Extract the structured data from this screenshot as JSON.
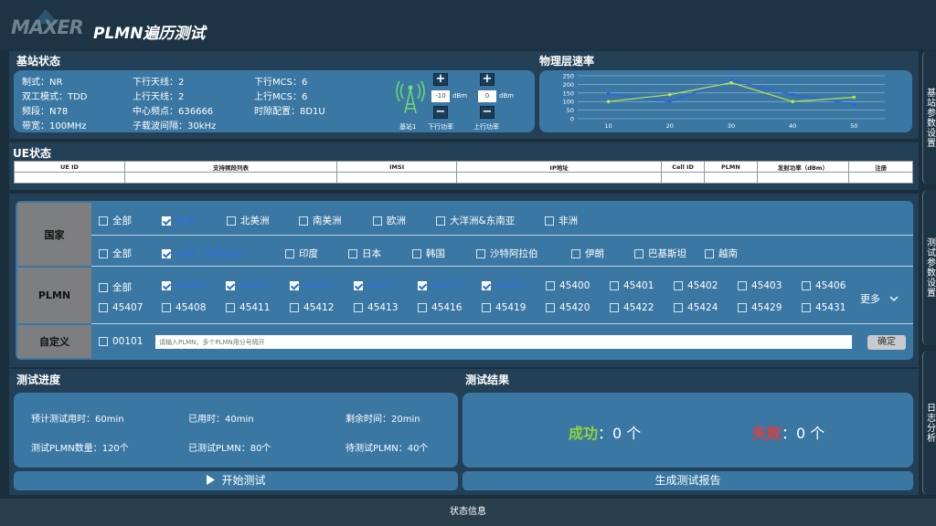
{
  "app": {
    "logo": "MAXER",
    "title": "PLMN遍历测试"
  },
  "base_station": {
    "title": "基站状态",
    "col1": [
      "制式：NR",
      "双工模式：TDD",
      "频段：N78",
      "带宽：100MHz"
    ],
    "col2": [
      "下行天线：2",
      "上行天线：2",
      "中心频点：636666",
      "子载波间隔：30kHz"
    ],
    "col3": [
      "下行MCS：6",
      "上行MCS：6",
      "时隙配置：8D1U"
    ],
    "antenna_label": "基站1",
    "dl_power": {
      "value": "-10",
      "unit": "dBm",
      "label": "下行功率"
    },
    "ul_power": {
      "value": "0",
      "unit": "dBm",
      "label": "上行功率"
    }
  },
  "rate": {
    "title": "物理层速率"
  },
  "chart_data": {
    "type": "line",
    "x": [
      10,
      20,
      30,
      40,
      50
    ],
    "series": [
      {
        "values": [
          145,
          100,
          225,
          140,
          85
        ]
      },
      {
        "values": [
          100,
          140,
          210,
          100,
          125
        ]
      }
    ],
    "xticks": [
      "10",
      "20",
      "30",
      "40",
      "50"
    ],
    "yticks": [
      "250",
      "200",
      "150",
      "100",
      "50",
      "0"
    ],
    "ylim": [
      0,
      250
    ],
    "grid": true,
    "colors": [
      "#2a63e0",
      "#b7e84e"
    ]
  },
  "ue": {
    "title": "UE状态",
    "columns": [
      "UE ID",
      "支持频段列表",
      "IMSI",
      "IP地址",
      "Cell ID",
      "PLMN",
      "发射功率（dBm）",
      "注册"
    ]
  },
  "country": {
    "label": "国家",
    "regions": [
      {
        "label": "全部",
        "checked": false
      },
      {
        "label": "亚洲",
        "checked": true
      },
      {
        "label": "北美洲",
        "checked": false
      },
      {
        "label": "南美洲",
        "checked": false
      },
      {
        "label": "欧洲",
        "checked": false
      },
      {
        "label": "大洋洲&东南亚",
        "checked": false
      },
      {
        "label": "非洲",
        "checked": false
      }
    ],
    "countries": [
      {
        "label": "全部",
        "checked": false
      },
      {
        "label": "中国（含港澳台）",
        "checked": true
      },
      {
        "label": "印度",
        "checked": false
      },
      {
        "label": "日本",
        "checked": false
      },
      {
        "label": "韩国",
        "checked": false
      },
      {
        "label": "沙特阿拉伯",
        "checked": false
      },
      {
        "label": "伊朗",
        "checked": false
      },
      {
        "label": "巴基斯坦",
        "checked": false
      },
      {
        "label": "越南",
        "checked": false
      }
    ]
  },
  "plmn": {
    "label": "PLMN",
    "row1": [
      {
        "label": "全部",
        "checked": false
      },
      {
        "label": "46000",
        "checked": true
      },
      {
        "label": "46001",
        "checked": true
      },
      {
        "label": "46003",
        "checked": true
      },
      {
        "label": "46011",
        "checked": true
      },
      {
        "label": "46015",
        "checked": true
      },
      {
        "label": "46020",
        "checked": true
      },
      {
        "label": "45400",
        "checked": false
      },
      {
        "label": "45401",
        "checked": false
      },
      {
        "label": "45402",
        "checked": false
      },
      {
        "label": "45403",
        "checked": false
      },
      {
        "label": "45406",
        "checked": false
      }
    ],
    "row2": [
      {
        "label": "45407",
        "checked": false
      },
      {
        "label": "45408",
        "checked": false
      },
      {
        "label": "45411",
        "checked": false
      },
      {
        "label": "45412",
        "checked": false
      },
      {
        "label": "45413",
        "checked": false
      },
      {
        "label": "45416",
        "checked": false
      },
      {
        "label": "45419",
        "checked": false
      },
      {
        "label": "45420",
        "checked": false
      },
      {
        "label": "45422",
        "checked": false
      },
      {
        "label": "45424",
        "checked": false
      },
      {
        "label": "45429",
        "checked": false
      },
      {
        "label": "45431",
        "checked": false
      }
    ],
    "more": "更多"
  },
  "custom": {
    "label": "自定义",
    "option": "00101",
    "placeholder": "请输入PLMN，多个PLMN用分号隔开",
    "confirm": "确定"
  },
  "progress": {
    "title": "测试进度",
    "items": [
      "预计测试用时：60min",
      "已用时：40min",
      "剩余时间：20min",
      "测试PLMN数量：120个",
      "已测试PLMN：80个",
      "待测试PLMN：40个"
    ],
    "start": "开始测试"
  },
  "results": {
    "title": "测试结果",
    "success_label": "成功",
    "success_value": "：0 个",
    "fail_label": "失败",
    "fail_value": "：0 个",
    "report": "生成测试报告",
    "success_color": "#8fd43a",
    "fail_color": "#e43c3c"
  },
  "side_tabs": [
    "基站参数设置",
    "测试参数设置",
    "日志分析"
  ],
  "status_bar": "状态信息"
}
